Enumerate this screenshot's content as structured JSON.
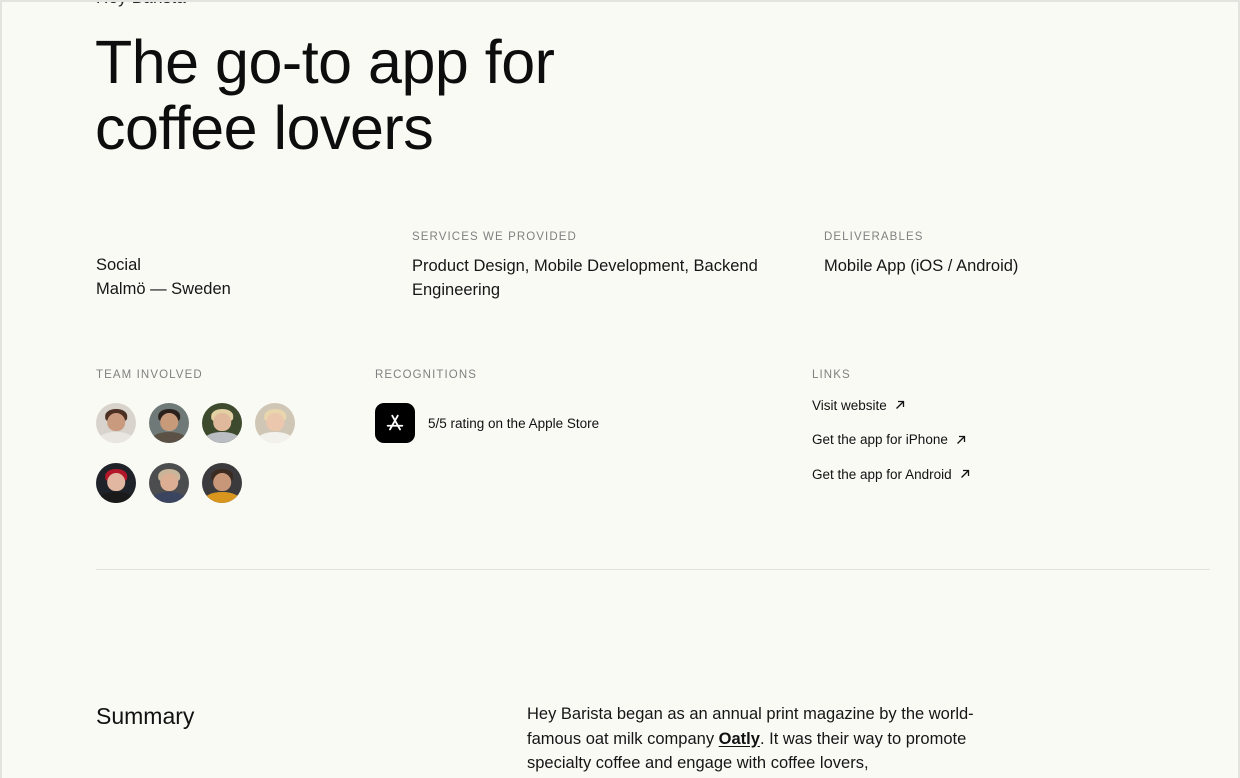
{
  "brand_clipped": "Hey Barista",
  "headline": {
    "line1": "The go-to app for",
    "line2": "coffee lovers"
  },
  "meta": {
    "client": {
      "category": "Social",
      "location": "Malmö — Sweden"
    },
    "services": {
      "label": "Services we provided",
      "value": "Product Design, Mobile Development, Backend Engineering"
    },
    "deliverables": {
      "label": "Deliverables",
      "value": "Mobile App (iOS / Android)"
    }
  },
  "team": {
    "label": "Team involved",
    "members": [
      {
        "bg": "#d8d3cc",
        "skin": "#c99a7e",
        "hair": "#4a2f22",
        "shirt": "#e9e6e2"
      },
      {
        "bg": "#6f7a78",
        "skin": "#c79a7a",
        "hair": "#2a211c",
        "shirt": "#5b5245"
      },
      {
        "bg": "#3e4a2e",
        "skin": "#e0b99c",
        "hair": "#e2cfa2",
        "shirt": "#b9bcc0"
      },
      {
        "bg": "#cfc6b5",
        "skin": "#eac7ad",
        "hair": "#e9d6ad",
        "shirt": "#f3f1ec"
      },
      {
        "bg": "#1f2329",
        "skin": "#e2b7a2",
        "hair": "#b3182a",
        "shirt": "#1a1a1a"
      },
      {
        "bg": "#4c4d4f",
        "skin": "#dcae94",
        "hair": "#c8b59a",
        "shirt": "#3c4560"
      },
      {
        "bg": "#3b3b3e",
        "skin": "#c8977a",
        "hair": "#3a2a20",
        "shirt": "#d9961f"
      }
    ]
  },
  "recognitions": {
    "label": "Recognitions",
    "items": [
      {
        "icon": "app-store-icon",
        "text": "5/5 rating on the Apple Store"
      }
    ]
  },
  "links": {
    "label": "Links",
    "items": [
      {
        "text": "Visit website",
        "icon": "arrow-up-right-icon"
      },
      {
        "text": "Get the app for iPhone",
        "icon": "arrow-up-right-icon"
      },
      {
        "text": "Get the app for Android",
        "icon": "arrow-up-right-icon"
      }
    ]
  },
  "summary": {
    "title": "Summary",
    "text_before": "Hey Barista began as an annual print magazine by the world-famous oat milk company ",
    "link_text": "Oatly",
    "text_after": ". It was their way to promote specialty coffee and engage with coffee lovers,"
  },
  "colors": {
    "background": "#fafaf5",
    "frame": "#e3e3df",
    "text": "#111111",
    "label": "#808080",
    "divider": "#e4e1da"
  }
}
